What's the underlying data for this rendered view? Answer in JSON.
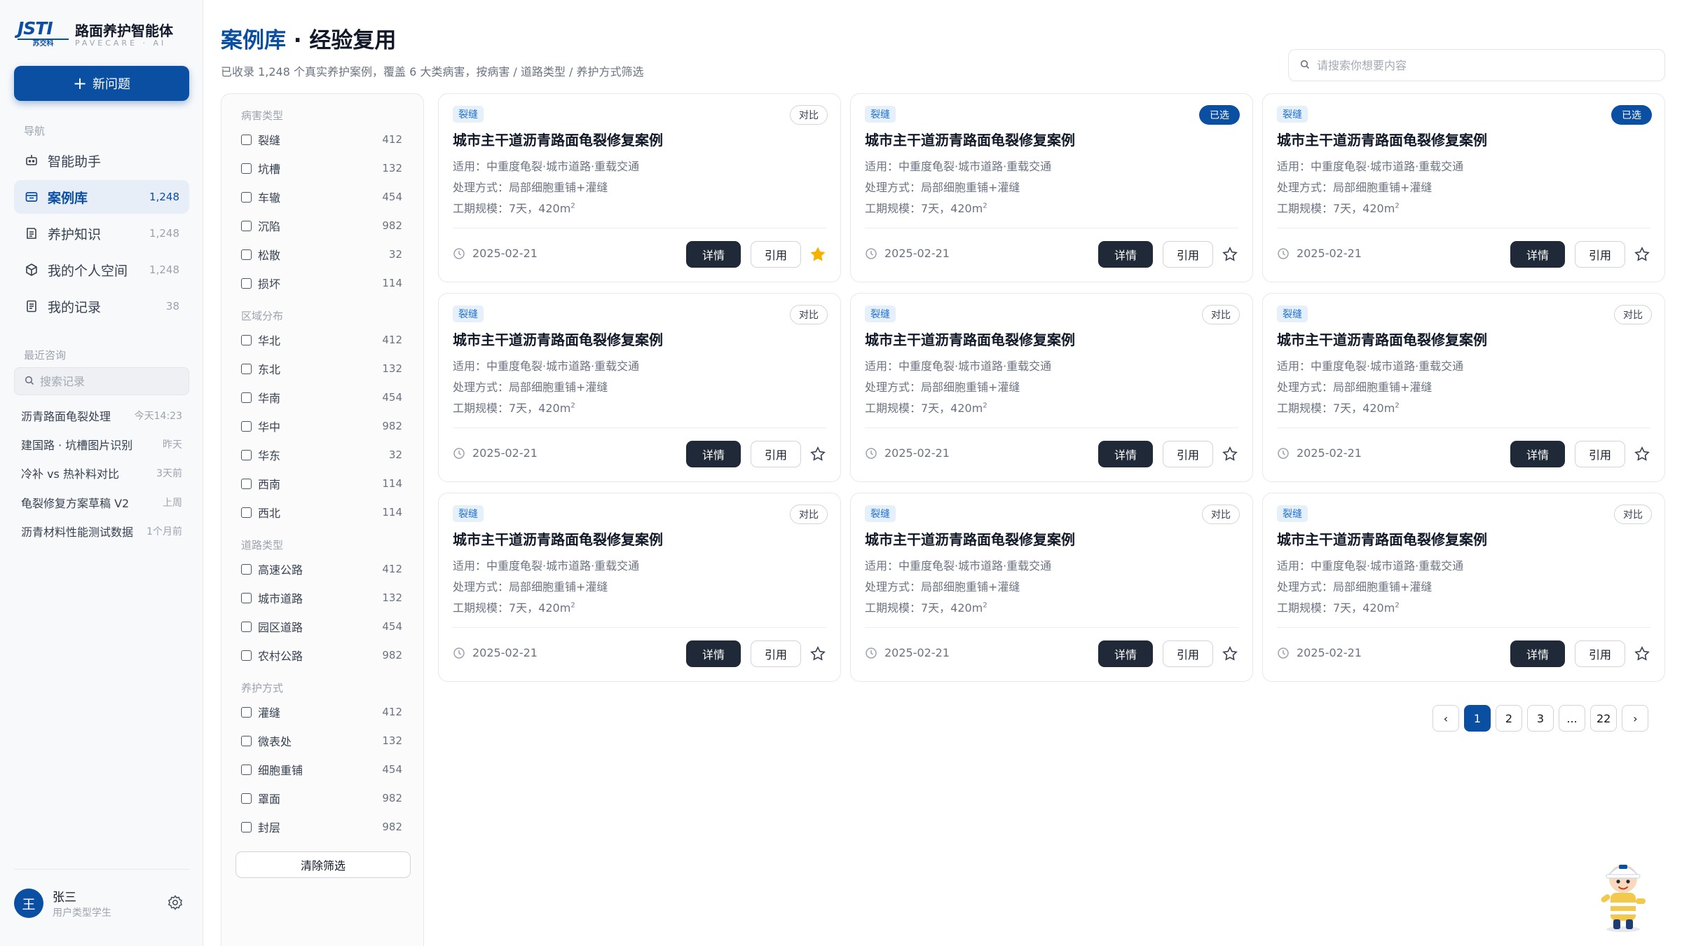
{
  "brand": {
    "logo_text": "JSTI",
    "logo_sub": "苏交科",
    "title": "路面养护智能体",
    "subtitle": "PAVECARE · AI"
  },
  "sidebar": {
    "new_button": "新问题",
    "nav_label": "导航",
    "nav": [
      {
        "label": "智能助手",
        "count": "",
        "icon": "robot-icon"
      },
      {
        "label": "案例库",
        "count": "1,248",
        "icon": "case-library-icon"
      },
      {
        "label": "养护知识",
        "count": "1,248",
        "icon": "book-icon"
      },
      {
        "label": "我的个人空间",
        "count": "1,248",
        "icon": "cube-icon"
      },
      {
        "label": "我的记录",
        "count": "38",
        "icon": "record-icon"
      }
    ],
    "recent_label": "最近咨询",
    "search_placeholder": "搜索记录",
    "recent": [
      {
        "title": "沥青路面龟裂处理",
        "time": "今天14:23"
      },
      {
        "title": "建国路 · 坑槽图片识别",
        "time": "昨天"
      },
      {
        "title": "冷补 vs 热补料对比",
        "time": "3天前"
      },
      {
        "title": "龟裂修复方案草稿 V2",
        "time": "上周"
      },
      {
        "title": "沥青材料性能测试数据",
        "time": "1个月前"
      }
    ],
    "user": {
      "avatar": "王",
      "name": "张三",
      "role": "用户类型学生"
    }
  },
  "header": {
    "title_highlight": "案例库",
    "title_rest": " · 经验复用",
    "subtitle": "已收录 1,248 个真实养护案例，覆盖 6 大类病害，按病害 / 道路类型 / 养护方式筛选",
    "search_placeholder": "请搜索你想要内容"
  },
  "filters": {
    "groups": [
      {
        "label": "病害类型",
        "items": [
          {
            "label": "裂缝",
            "count": "412"
          },
          {
            "label": "坑槽",
            "count": "132"
          },
          {
            "label": "车辙",
            "count": "454"
          },
          {
            "label": "沉陷",
            "count": "982"
          },
          {
            "label": "松散",
            "count": "32"
          },
          {
            "label": "损坏",
            "count": "114"
          }
        ]
      },
      {
        "label": "区域分布",
        "items": [
          {
            "label": "华北",
            "count": "412"
          },
          {
            "label": "东北",
            "count": "132"
          },
          {
            "label": "华南",
            "count": "454"
          },
          {
            "label": "华中",
            "count": "982"
          },
          {
            "label": "华东",
            "count": "32"
          },
          {
            "label": "西南",
            "count": "114"
          },
          {
            "label": "西北",
            "count": "114"
          }
        ]
      },
      {
        "label": "道路类型",
        "items": [
          {
            "label": "高速公路",
            "count": "412"
          },
          {
            "label": "城市道路",
            "count": "132"
          },
          {
            "label": "园区道路",
            "count": "454"
          },
          {
            "label": "农村公路",
            "count": "982"
          }
        ]
      },
      {
        "label": "养护方式",
        "items": [
          {
            "label": "灌缝",
            "count": "412"
          },
          {
            "label": "微表处",
            "count": "132"
          },
          {
            "label": "细胞重铺",
            "count": "454"
          },
          {
            "label": "罩面",
            "count": "982"
          },
          {
            "label": "封层",
            "count": "982"
          }
        ]
      }
    ],
    "clear_button": "清除筛选"
  },
  "cards": [
    {
      "tag": "裂缝",
      "status": "对比",
      "selected": false,
      "starred": true
    },
    {
      "tag": "裂缝",
      "status": "已选",
      "selected": true,
      "starred": false
    },
    {
      "tag": "裂缝",
      "status": "已选",
      "selected": true,
      "starred": false
    },
    {
      "tag": "裂缝",
      "status": "对比",
      "selected": false,
      "starred": false
    },
    {
      "tag": "裂缝",
      "status": "对比",
      "selected": false,
      "starred": false
    },
    {
      "tag": "裂缝",
      "status": "对比",
      "selected": false,
      "starred": false
    },
    {
      "tag": "裂缝",
      "status": "对比",
      "selected": false,
      "starred": false
    },
    {
      "tag": "裂缝",
      "status": "对比",
      "selected": false,
      "starred": false
    },
    {
      "tag": "裂缝",
      "status": "对比",
      "selected": false,
      "starred": false
    }
  ],
  "card_common": {
    "title": "城市主干道沥青路面龟裂修复案例",
    "apply": "适用：中重度龟裂·城市道路·重载交通",
    "method": "处理方式：局部细胞重铺+灌缝",
    "scale": "工期规模：7天，420m",
    "scale_unit_sup": "2",
    "date": "2025-02-21",
    "detail_button": "详情",
    "cite_button": "引用"
  },
  "pagination": {
    "prev": "‹",
    "pages": [
      "1",
      "2",
      "3",
      "...",
      "22"
    ],
    "next": "›",
    "current": "1"
  },
  "colors": {
    "primary": "#0b4fa3",
    "dark_button": "#1f2937",
    "tag_bg": "#e6f0fb",
    "star_active": "#f5b301"
  }
}
